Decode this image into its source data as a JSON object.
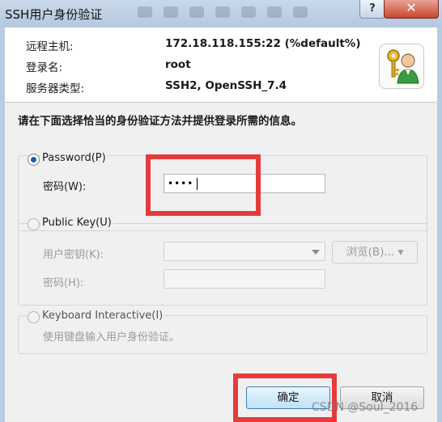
{
  "window": {
    "title": "SSH用户身份验证",
    "help_label": "?",
    "close_label": "✕"
  },
  "info": {
    "host_label": "远程主机:",
    "host_value": "172.18.118.155:22 (%default%)",
    "login_label": "登录名:",
    "login_value": "root",
    "server_type_label": "服务器类型:",
    "server_type_value": "SSH2, OpenSSH_7.4"
  },
  "prompt": "请在下面选择恰当的身份验证方法并提供登录所需的信息。",
  "password_method": {
    "radio_label": "Password(P)",
    "selected": true,
    "password_label": "密码(W):",
    "password_value": "••••"
  },
  "public_key_method": {
    "radio_label": "Public Key(U)",
    "selected": false,
    "user_key_label": "用户密钥(K):",
    "browse_label": "浏览(B)...",
    "passphrase_label": "密码(H):"
  },
  "keyboard_method": {
    "radio_label": "Keyboard Interactive(I)",
    "selected": false,
    "description": "使用键盘输入用户身份验证。"
  },
  "buttons": {
    "ok_label": "确定",
    "cancel_label": "取消"
  },
  "watermark": "CSDN @Soul_2016",
  "colors": {
    "highlight_box": "#e53b3b",
    "title_bar": "#b9cbe0",
    "close_button": "#c9462f"
  },
  "icons": [
    "help-icon",
    "close-icon",
    "user-key-icon",
    "dropdown-arrow-icon"
  ]
}
